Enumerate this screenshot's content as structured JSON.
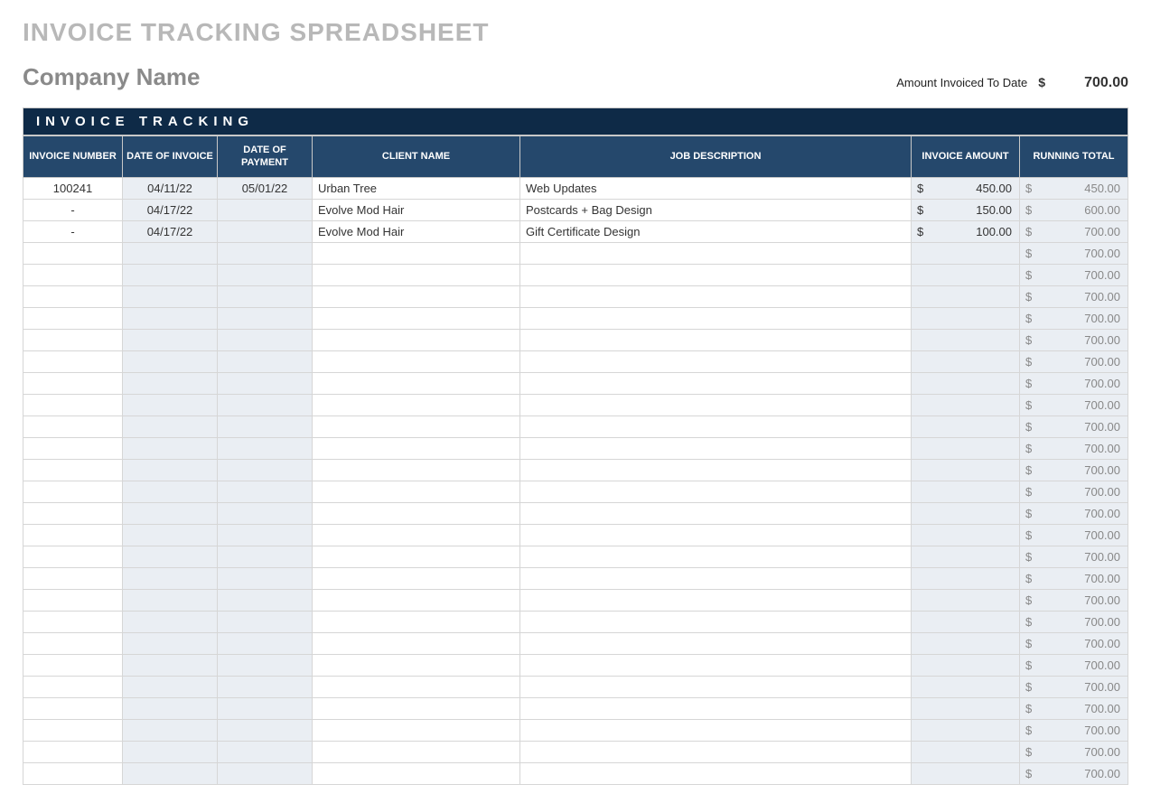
{
  "title": "INVOICE TRACKING SPREADSHEET",
  "company": "Company Name",
  "summary": {
    "label": "Amount Invoiced To Date",
    "currency": "$",
    "value": "700.00"
  },
  "section_heading": "INVOICE TRACKING",
  "columns": {
    "invoice_number": "INVOICE NUMBER",
    "date_invoice": "DATE OF INVOICE",
    "date_payment": "DATE OF PAYMENT",
    "client_name": "CLIENT NAME",
    "job_description": "JOB DESCRIPTION",
    "invoice_amount": "INVOICE AMOUNT",
    "running_total": "RUNNING TOTAL"
  },
  "rows": [
    {
      "invoice_number": "100241",
      "date_invoice": "04/11/22",
      "date_payment": "05/01/22",
      "client": "Urban Tree",
      "desc": "Web Updates",
      "amount": "450.00",
      "running": "450.00"
    },
    {
      "invoice_number": "-",
      "date_invoice": "04/17/22",
      "date_payment": "",
      "client": "Evolve Mod Hair",
      "desc": "Postcards + Bag Design",
      "amount": "150.00",
      "running": "600.00"
    },
    {
      "invoice_number": "-",
      "date_invoice": "04/17/22",
      "date_payment": "",
      "client": "Evolve Mod Hair",
      "desc": "Gift Certificate Design",
      "amount": "100.00",
      "running": "700.00"
    },
    {
      "invoice_number": "",
      "date_invoice": "",
      "date_payment": "",
      "client": "",
      "desc": "",
      "amount": "",
      "running": "700.00"
    },
    {
      "invoice_number": "",
      "date_invoice": "",
      "date_payment": "",
      "client": "",
      "desc": "",
      "amount": "",
      "running": "700.00"
    },
    {
      "invoice_number": "",
      "date_invoice": "",
      "date_payment": "",
      "client": "",
      "desc": "",
      "amount": "",
      "running": "700.00"
    },
    {
      "invoice_number": "",
      "date_invoice": "",
      "date_payment": "",
      "client": "",
      "desc": "",
      "amount": "",
      "running": "700.00"
    },
    {
      "invoice_number": "",
      "date_invoice": "",
      "date_payment": "",
      "client": "",
      "desc": "",
      "amount": "",
      "running": "700.00"
    },
    {
      "invoice_number": "",
      "date_invoice": "",
      "date_payment": "",
      "client": "",
      "desc": "",
      "amount": "",
      "running": "700.00"
    },
    {
      "invoice_number": "",
      "date_invoice": "",
      "date_payment": "",
      "client": "",
      "desc": "",
      "amount": "",
      "running": "700.00"
    },
    {
      "invoice_number": "",
      "date_invoice": "",
      "date_payment": "",
      "client": "",
      "desc": "",
      "amount": "",
      "running": "700.00"
    },
    {
      "invoice_number": "",
      "date_invoice": "",
      "date_payment": "",
      "client": "",
      "desc": "",
      "amount": "",
      "running": "700.00"
    },
    {
      "invoice_number": "",
      "date_invoice": "",
      "date_payment": "",
      "client": "",
      "desc": "",
      "amount": "",
      "running": "700.00"
    },
    {
      "invoice_number": "",
      "date_invoice": "",
      "date_payment": "",
      "client": "",
      "desc": "",
      "amount": "",
      "running": "700.00"
    },
    {
      "invoice_number": "",
      "date_invoice": "",
      "date_payment": "",
      "client": "",
      "desc": "",
      "amount": "",
      "running": "700.00"
    },
    {
      "invoice_number": "",
      "date_invoice": "",
      "date_payment": "",
      "client": "",
      "desc": "",
      "amount": "",
      "running": "700.00"
    },
    {
      "invoice_number": "",
      "date_invoice": "",
      "date_payment": "",
      "client": "",
      "desc": "",
      "amount": "",
      "running": "700.00"
    },
    {
      "invoice_number": "",
      "date_invoice": "",
      "date_payment": "",
      "client": "",
      "desc": "",
      "amount": "",
      "running": "700.00"
    },
    {
      "invoice_number": "",
      "date_invoice": "",
      "date_payment": "",
      "client": "",
      "desc": "",
      "amount": "",
      "running": "700.00"
    },
    {
      "invoice_number": "",
      "date_invoice": "",
      "date_payment": "",
      "client": "",
      "desc": "",
      "amount": "",
      "running": "700.00"
    },
    {
      "invoice_number": "",
      "date_invoice": "",
      "date_payment": "",
      "client": "",
      "desc": "",
      "amount": "",
      "running": "700.00"
    },
    {
      "invoice_number": "",
      "date_invoice": "",
      "date_payment": "",
      "client": "",
      "desc": "",
      "amount": "",
      "running": "700.00"
    },
    {
      "invoice_number": "",
      "date_invoice": "",
      "date_payment": "",
      "client": "",
      "desc": "",
      "amount": "",
      "running": "700.00"
    },
    {
      "invoice_number": "",
      "date_invoice": "",
      "date_payment": "",
      "client": "",
      "desc": "",
      "amount": "",
      "running": "700.00"
    },
    {
      "invoice_number": "",
      "date_invoice": "",
      "date_payment": "",
      "client": "",
      "desc": "",
      "amount": "",
      "running": "700.00"
    },
    {
      "invoice_number": "",
      "date_invoice": "",
      "date_payment": "",
      "client": "",
      "desc": "",
      "amount": "",
      "running": "700.00"
    },
    {
      "invoice_number": "",
      "date_invoice": "",
      "date_payment": "",
      "client": "",
      "desc": "",
      "amount": "",
      "running": "700.00"
    },
    {
      "invoice_number": "",
      "date_invoice": "",
      "date_payment": "",
      "client": "",
      "desc": "",
      "amount": "",
      "running": "700.00"
    }
  ]
}
